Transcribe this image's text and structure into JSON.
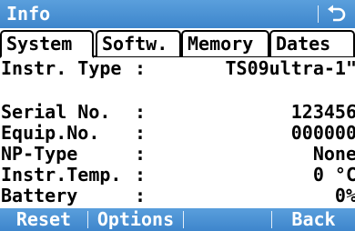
{
  "window": {
    "title": "Info"
  },
  "tabs": [
    {
      "label": "System",
      "active": true
    },
    {
      "label": "Softw.",
      "active": false
    },
    {
      "label": "Memory",
      "active": false
    },
    {
      "label": "Dates",
      "active": false
    }
  ],
  "rows": [
    {
      "label": "Instr. Type",
      "sep": ":",
      "value": "TS09ultra-1\""
    },
    {
      "label": "Serial No.",
      "sep": ":",
      "value": "123456"
    },
    {
      "label": "Equip.No.",
      "sep": ":",
      "value": "000000"
    },
    {
      "label": "NP-Type",
      "sep": ":",
      "value": "None"
    },
    {
      "label": "Instr.Temp.",
      "sep": ":",
      "value": "0 °C"
    },
    {
      "label": "Battery",
      "sep": ":",
      "value": "0%"
    }
  ],
  "softkeys": [
    {
      "label": "Reset"
    },
    {
      "label": "Options"
    },
    {
      "label": ""
    },
    {
      "label": "Back"
    }
  ],
  "colors": {
    "bar": "#4a92d6",
    "text": "#000000",
    "bar_text": "#ffffff"
  },
  "icons": {
    "title_back": "return-arrow-icon"
  }
}
